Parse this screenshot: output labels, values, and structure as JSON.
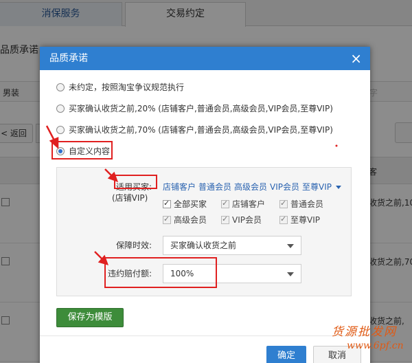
{
  "tabs": [
    {
      "label": "消保服务"
    },
    {
      "label": "交易约定"
    }
  ],
  "page": {
    "heading": "品质承诺",
    "row1_left": "男装",
    "row1_right": "字",
    "back_button": "< 返回",
    "table_header_right": "客",
    "rows": [
      {
        "text": "收货之前,10"
      },
      {
        "text": "收货之前,70"
      },
      {
        "text": "收货之前,"
      }
    ]
  },
  "dialog": {
    "title": "品质承诺",
    "close": "×",
    "options": [
      {
        "label": "未约定，按照淘宝争议规范执行",
        "selected": false
      },
      {
        "label": "买家确认收货之前,20% (店铺客户,普通会员,高级会员,VIP会员,至尊VIP)",
        "selected": false
      },
      {
        "label": "买家确认收货之前,70% (店铺客户,普通会员,高级会员,VIP会员,至尊VIP)",
        "selected": false
      },
      {
        "label": "自定义内容",
        "selected": true
      }
    ],
    "buyer_label": "适用买家:",
    "buyer_sublabel": "(店铺VIP)",
    "buyer_groups": [
      "店铺客户",
      "普通会员",
      "高级会员",
      "VIP会员",
      "至尊VIP"
    ],
    "checkboxes": [
      {
        "label": "全部买家",
        "checked": true,
        "disabled": false
      },
      {
        "label": "店铺客户",
        "checked": true,
        "disabled": true
      },
      {
        "label": "普通会员",
        "checked": true,
        "disabled": true
      },
      {
        "label": "高级会员",
        "checked": true,
        "disabled": true
      },
      {
        "label": "VIP会员",
        "checked": true,
        "disabled": true
      },
      {
        "label": "至尊VIP",
        "checked": true,
        "disabled": true
      }
    ],
    "timing_label": "保障时效:",
    "timing_value": "买家确认收货之前",
    "compensation_label": "违约赔付额:",
    "compensation_value": "100%",
    "save_template": "保存为模版",
    "ok": "确定",
    "cancel": "取消"
  },
  "watermark": {
    "line1": "货源批发网",
    "line2": "www.6pf.cn"
  },
  "colors": {
    "header_blue": "#2f7fd0",
    "save_green": "#3d8c3a",
    "annotation_red": "#e02020",
    "link_blue": "#2a63b0"
  }
}
